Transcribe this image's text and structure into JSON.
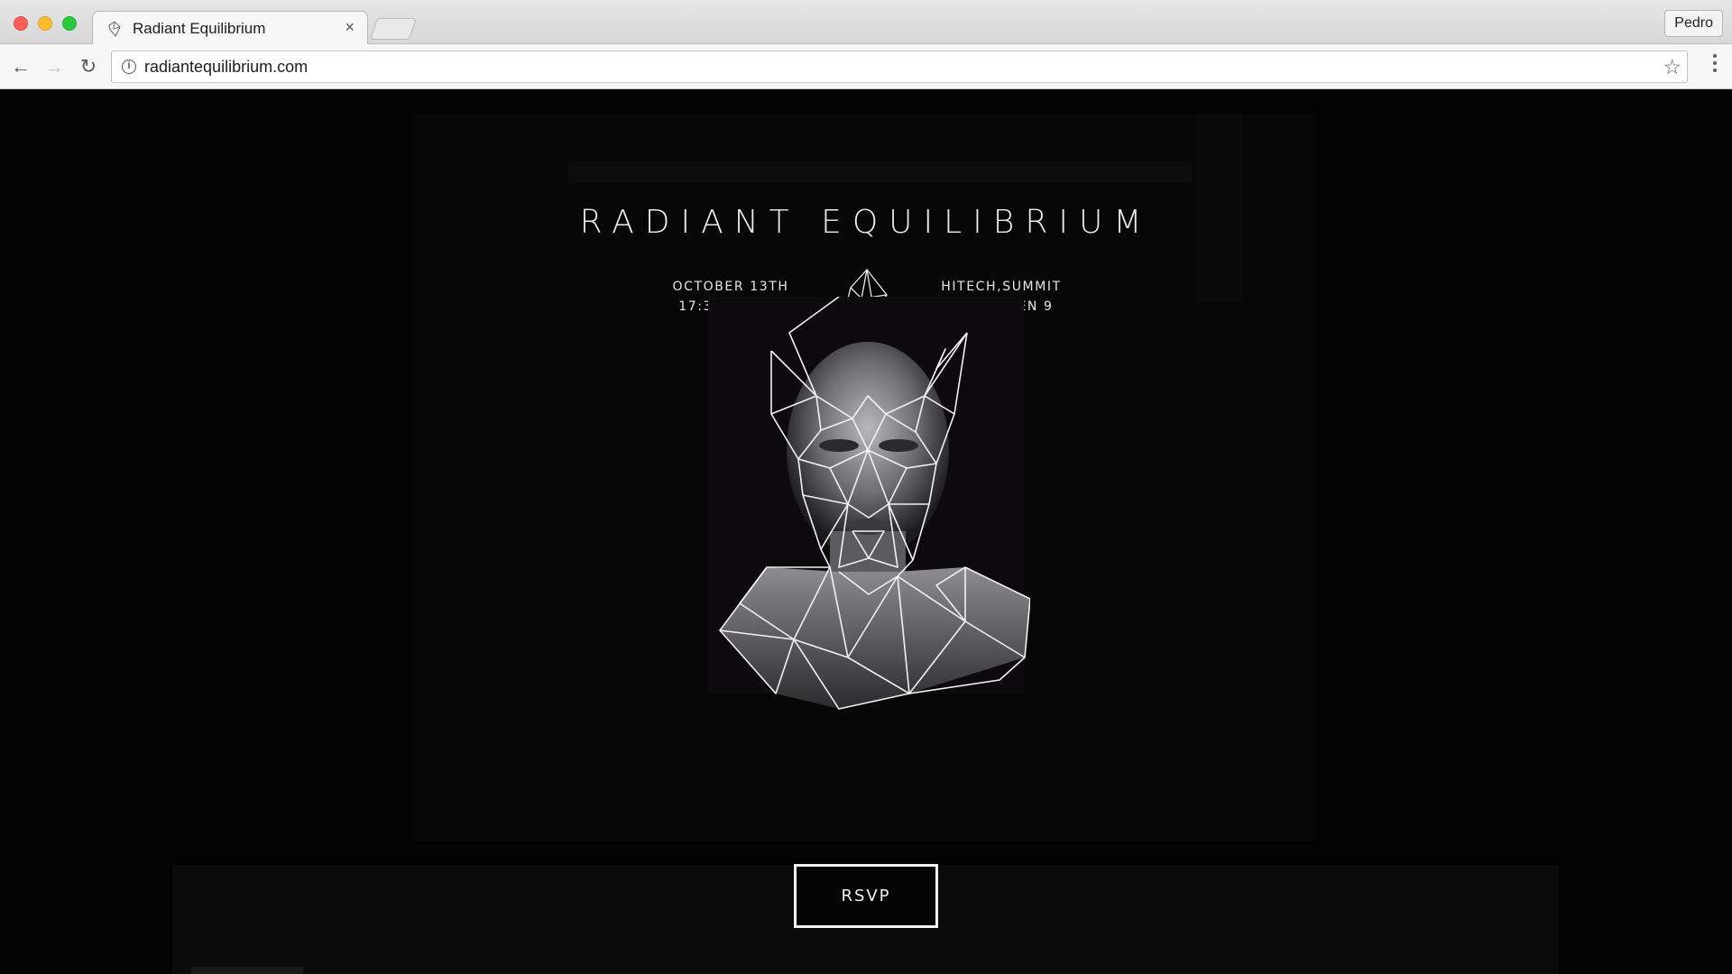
{
  "browser": {
    "tab_title": "Radiant Equilibrium",
    "tab_close": "×",
    "profile_name": "Pedro",
    "url": "radiantequilibrium.com",
    "info_glyph": "i",
    "star_glyph": "☆",
    "back_glyph": "←",
    "forward_glyph": "→",
    "reload_glyph": "↻",
    "icons": [
      "favicon-icon",
      "back-arrow-icon",
      "forward-arrow-icon",
      "reload-icon",
      "info-icon",
      "star-icon",
      "menu-dots-icon"
    ]
  },
  "event": {
    "title": "RADIANT EQUILIBRIUM",
    "date": "OCTOBER 13TH",
    "time": "17:30 - 21:30",
    "venue": "HITECH,SUMMIT",
    "address": "SVEAVÄGEN 9",
    "rsvp_label": "RSVP"
  },
  "colors": {
    "page_background": "#030303",
    "poster_background": "#070707",
    "text": "#ededed",
    "button_border": "#f2f2f2"
  }
}
